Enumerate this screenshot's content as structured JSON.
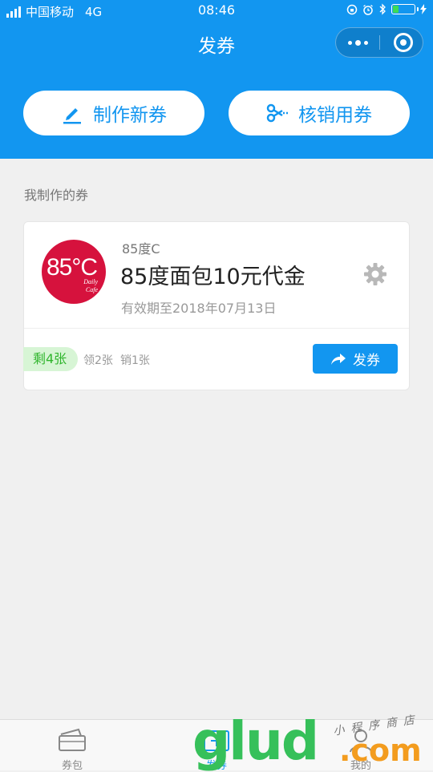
{
  "status_bar": {
    "carrier": "中国移动",
    "network": "4G",
    "time": "08:46"
  },
  "nav": {
    "title": "发券"
  },
  "actions": {
    "create_label": "制作新券",
    "verify_label": "核销用券"
  },
  "section": {
    "label": "我制作的券"
  },
  "coupon": {
    "logo_big": "85°C",
    "logo_small_1": "Daily",
    "logo_small_2": "Cafe",
    "brand": "85度C",
    "title": "85度面包10元代金",
    "validity": "有效期至2018年07月13日",
    "remaining": "剩4张",
    "claimed": "领2张",
    "redeemed": "销1张",
    "issue_label": "发券"
  },
  "tabs": [
    {
      "label": "券包"
    },
    {
      "label": "发券"
    },
    {
      "label": "我的"
    }
  ],
  "watermark": {
    "brand": "glud",
    "suffix": ".com",
    "tagline": "小程序商店"
  },
  "colors": {
    "primary": "#1296f0",
    "background": "#f0f0f0",
    "logo_red": "#d6123d",
    "remaining_green": "#2fb52c"
  }
}
